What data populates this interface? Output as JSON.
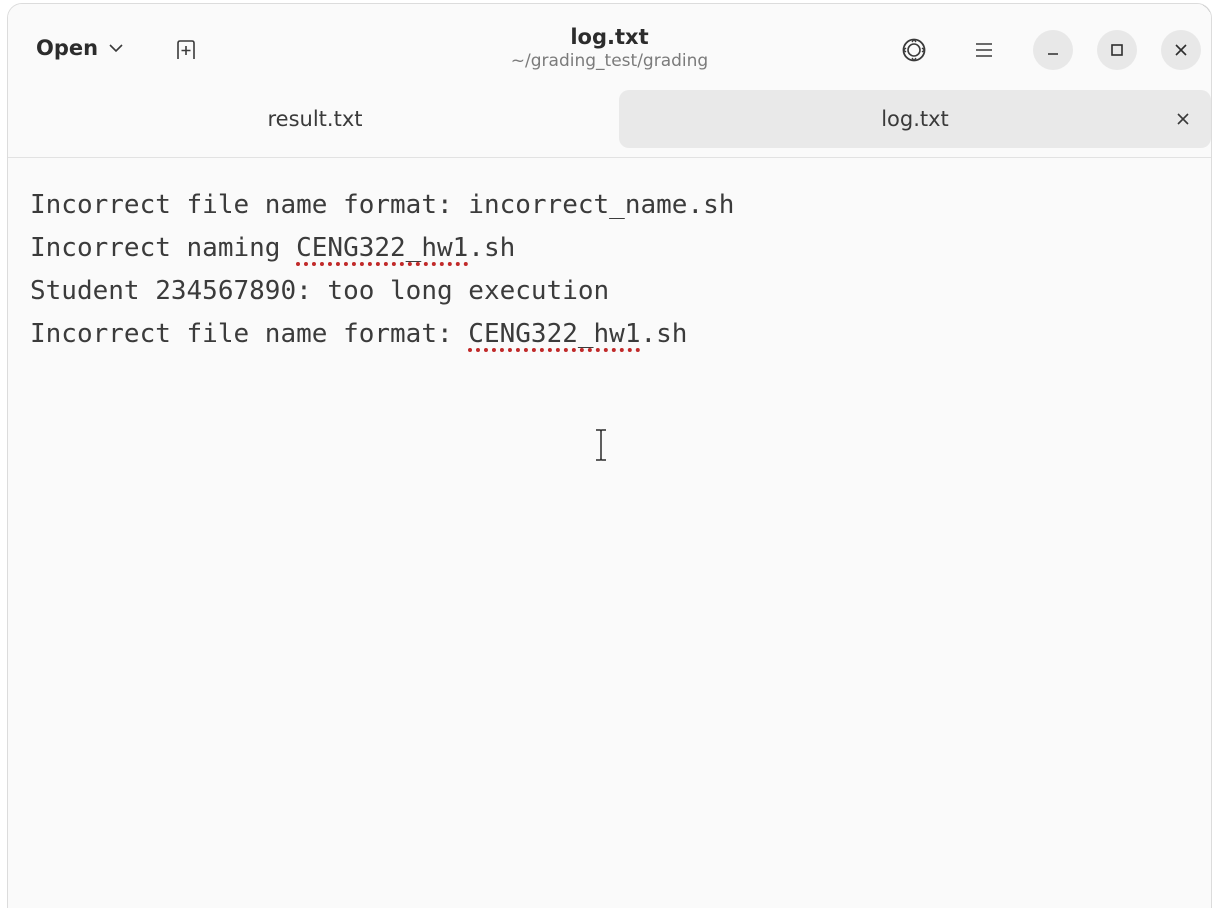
{
  "header": {
    "open_label": "Open",
    "title": "log.txt",
    "subtitle": "~/grading_test/grading",
    "icons": [
      "chevron-down-icon",
      "new-tab-icon",
      "settings-icon",
      "hamburger-menu-icon",
      "minimize-icon",
      "maximize-icon",
      "close-icon"
    ]
  },
  "tabs": [
    {
      "label": "result.txt",
      "active": false
    },
    {
      "label": "log.txt",
      "active": true
    }
  ],
  "editor": {
    "lines": [
      [
        {
          "text": "Incorrect file name format: incorrect_name.sh",
          "misspelled": false
        }
      ],
      [
        {
          "text": "Incorrect naming ",
          "misspelled": false
        },
        {
          "text": "CENG322_hw1",
          "misspelled": true
        },
        {
          "text": ".sh",
          "misspelled": false
        }
      ],
      [
        {
          "text": "Student 234567890: too long execution",
          "misspelled": false
        }
      ],
      [
        {
          "text": "Incorrect file name format: ",
          "misspelled": false
        },
        {
          "text": "CENG322_hw1",
          "misspelled": true
        },
        {
          "text": ".sh",
          "misspelled": false
        }
      ]
    ]
  },
  "colors": {
    "spellcheck_underline": "#c12a2a",
    "active_tab_bg": "#e9e9e9",
    "window_bg": "#fafafa"
  }
}
